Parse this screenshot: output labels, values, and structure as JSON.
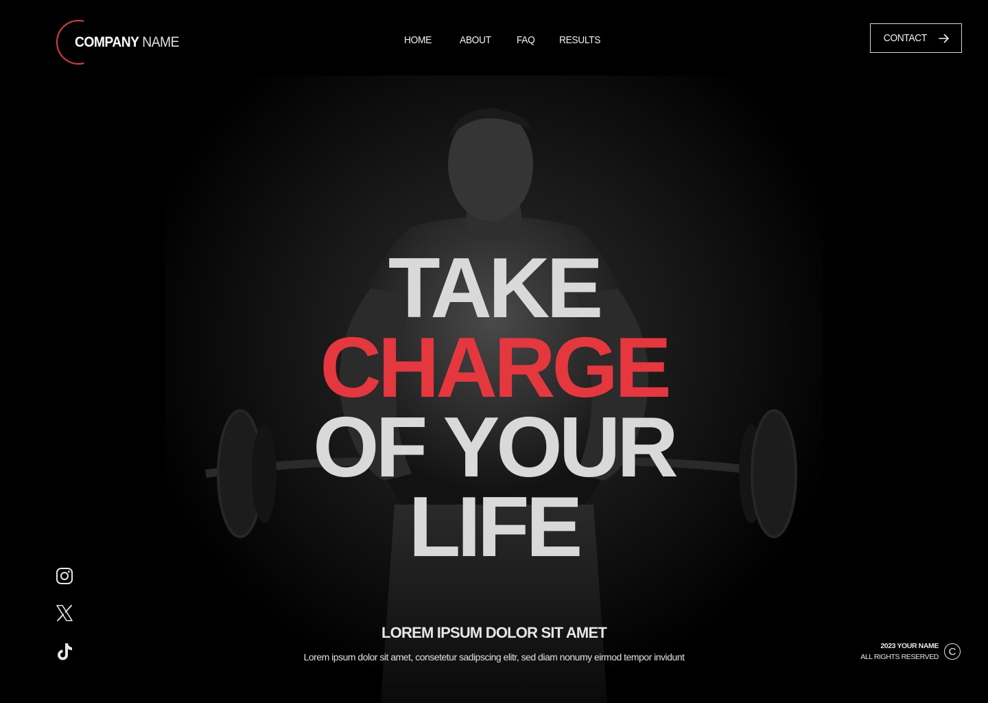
{
  "brand": {
    "name_bold": "COMPANY",
    "name_light": "NAME",
    "accent_color": "#e4383e"
  },
  "nav": {
    "items": [
      "HOME",
      "ABOUT",
      "FAQ",
      "RESULTS"
    ]
  },
  "contact": {
    "label": "CONTACT",
    "icon": "arrow-right-icon"
  },
  "hero": {
    "lines": [
      "TAKE",
      "CHARGE",
      "OF YOUR",
      "LIFE"
    ],
    "subtitle": "LOREM IPSUM DOLOR SIT AMET",
    "description": "Lorem ipsum dolor sit amet, consetetur sadipscing elitr, sed diam nonumy eirmod tempor invidunt",
    "background": "man-lifting-barbell-photo"
  },
  "social": [
    "instagram-icon",
    "x-icon",
    "tiktok-icon"
  ],
  "footer": {
    "year_name": "2023 YOUR NAME",
    "rights": "ALL RIGHTS RESERVED",
    "icon": "copyright-icon"
  }
}
